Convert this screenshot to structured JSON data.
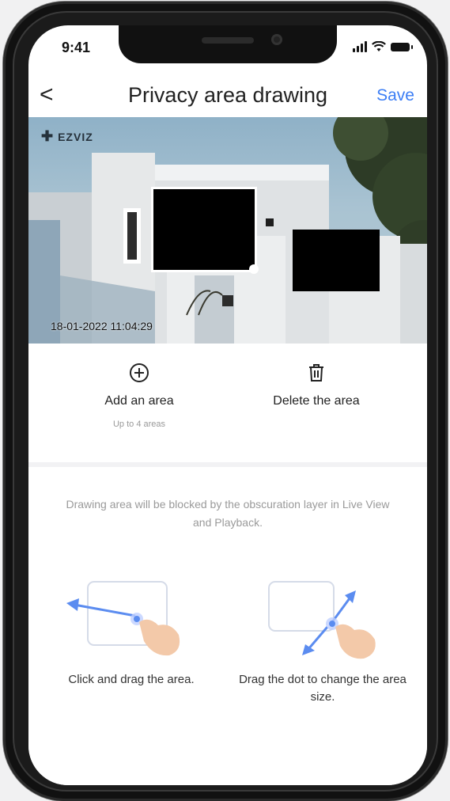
{
  "status_bar": {
    "time": "9:41"
  },
  "nav": {
    "back": "<",
    "title": "Privacy area drawing",
    "save": "Save"
  },
  "camera": {
    "brand": "EZVIZ",
    "timestamp": "18-01-2022 11:04:29"
  },
  "actions": {
    "add": {
      "label": "Add an area",
      "sub": "Up to 4 areas",
      "icon": "plus-circle-icon"
    },
    "delete": {
      "label": "Delete the area",
      "icon": "trash-icon"
    }
  },
  "info": {
    "description": "Drawing area will be blocked by the obscuration layer in Live View and Playback.",
    "tip1": "Click and drag the area.",
    "tip2": "Drag the dot to change the area size."
  },
  "colors": {
    "accent": "#3c7ef5",
    "illustration_arrow": "#5b8cf0",
    "hand": "#f3c9a9"
  }
}
